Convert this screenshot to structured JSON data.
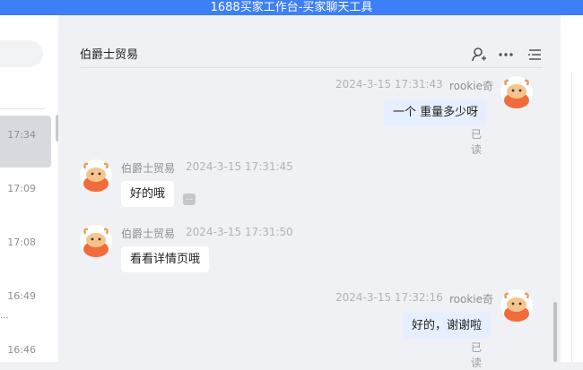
{
  "window": {
    "title": "1688买家工作台-买家聊天工具"
  },
  "session_list": {
    "times": [
      "17:34",
      "17:09",
      "17:08",
      "16:49",
      "16:46"
    ],
    "ellipsis": "..."
  },
  "chat": {
    "title": "伯爵士贸易",
    "header_icons": [
      "add-user-icon",
      "more-icon",
      "menu-icon"
    ],
    "messages": [
      {
        "sender": "rookie奇",
        "time": "2024-3-15 17:31:43",
        "text": "一个  重量多少呀",
        "status": "已读"
      },
      {
        "sender": "伯爵士贸易",
        "time": "2024-3-15 17:31:45",
        "text": "好的哦",
        "more": "..."
      },
      {
        "sender": "伯爵士贸易",
        "time": "2024-3-15 17:31:50",
        "text": "看看详情页哦"
      },
      {
        "sender": "rookie奇",
        "time": "2024-3-15 17:32:16",
        "text": "好的，谢谢啦",
        "status": "已读"
      }
    ]
  },
  "colors": {
    "titlebar": "#3d7ff6",
    "outgoing_bubble": "#e5efff",
    "incoming_bubble": "#ffffff",
    "avatar": "#f26b3a"
  }
}
